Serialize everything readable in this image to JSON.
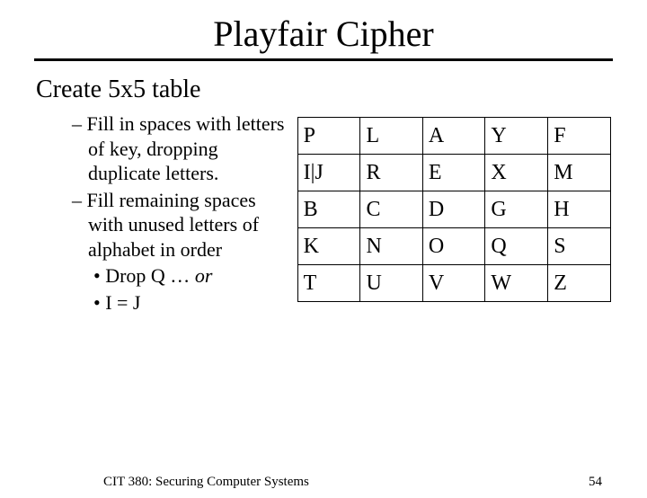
{
  "title": "Playfair Cipher",
  "heading": "Create 5x5 table",
  "step1": "Fill in spaces with letters of key, dropping duplicate letters.",
  "step2": "Fill remaining spaces with unused letters of alphabet in order",
  "sub1_a": "Drop Q … ",
  "sub1_b": "or",
  "sub2": "I = J",
  "grid": {
    "r0c0": "P",
    "r0c1": "L",
    "r0c2": "A",
    "r0c3": "Y",
    "r0c4": "F",
    "r1c0": "I|J",
    "r1c1": "R",
    "r1c2": "E",
    "r1c3": "X",
    "r1c4": "M",
    "r2c0": "B",
    "r2c1": "C",
    "r2c2": "D",
    "r2c3": "G",
    "r2c4": "H",
    "r3c0": "K",
    "r3c1": "N",
    "r3c2": "O",
    "r3c3": "Q",
    "r3c4": "S",
    "r4c0": "T",
    "r4c1": "U",
    "r4c2": "V",
    "r4c3": "W",
    "r4c4": "Z"
  },
  "footer": {
    "course": "CIT 380: Securing Computer Systems",
    "page": "54"
  }
}
